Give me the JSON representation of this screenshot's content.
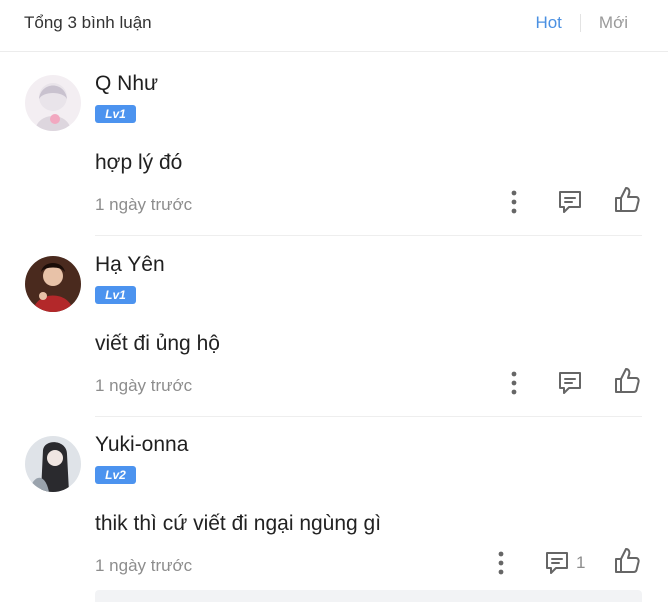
{
  "header": {
    "title": "Tổng 3 bình luận",
    "sort_hot": "Hot",
    "sort_new": "Mới"
  },
  "colors": {
    "accent": "#4a90e2",
    "level_badge": "#4c93ef",
    "muted": "#8d8d8d"
  },
  "comments": [
    {
      "name": "Q Như",
      "level": "Lv1",
      "text": "hợp lý đó",
      "time": "1 ngày trước",
      "reply_count": ""
    },
    {
      "name": "Hạ Yên",
      "level": "Lv1",
      "text": "viết đi ủng hộ",
      "time": "1 ngày trước",
      "reply_count": ""
    },
    {
      "name": "Yuki-onna",
      "level": "Lv2",
      "text": "thik thì cứ viết đi ngại ngùng gì",
      "time": "1 ngày trước",
      "reply_count": "1"
    }
  ]
}
